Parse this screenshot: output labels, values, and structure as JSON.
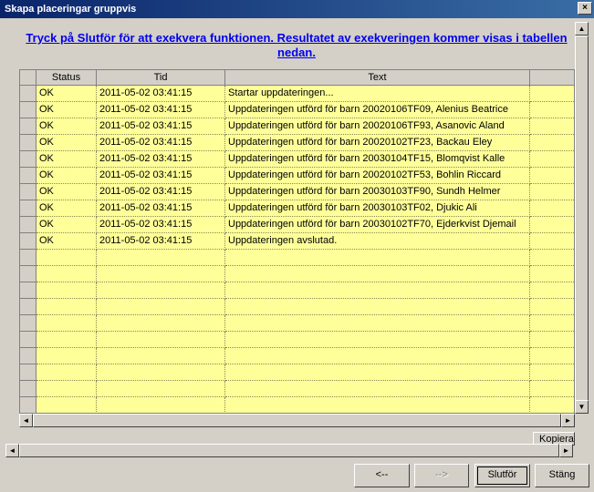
{
  "window": {
    "title": "Skapa placeringar gruppvis",
    "close_label": "×"
  },
  "instruction": "Tryck på Slutför för att exekvera funktionen. Resultatet av exekveringen kommer visas i tabellen nedan.",
  "table": {
    "columns": [
      "Status",
      "Tid",
      "Text"
    ],
    "rows": [
      [
        "OK",
        "2011-05-02 03:41:15",
        "Startar uppdateringen..."
      ],
      [
        "OK",
        "2011-05-02 03:41:15",
        "Uppdateringen utförd för barn 20020106TF09, Alenius Beatrice"
      ],
      [
        "OK",
        "2011-05-02 03:41:15",
        "Uppdateringen utförd för barn 20020106TF93, Asanovic Aland"
      ],
      [
        "OK",
        "2011-05-02 03:41:15",
        "Uppdateringen utförd för barn 20020102TF23, Backau Eley"
      ],
      [
        "OK",
        "2011-05-02 03:41:15",
        "Uppdateringen utförd för barn 20030104TF15, Blomqvist Kalle"
      ],
      [
        "OK",
        "2011-05-02 03:41:15",
        "Uppdateringen utförd för barn 20020102TF53, Bohlin Riccard"
      ],
      [
        "OK",
        "2011-05-02 03:41:15",
        "Uppdateringen utförd för barn 20030103TF90, Sundh Helmer"
      ],
      [
        "OK",
        "2011-05-02 03:41:15",
        "Uppdateringen utförd för barn 20030103TF02, Djukic Ali"
      ],
      [
        "OK",
        "2011-05-02 03:41:15",
        "Uppdateringen utförd för barn 20030102TF70, Ejderkvist Djemail"
      ],
      [
        "OK",
        "2011-05-02 03:41:15",
        "Uppdateringen avslutad."
      ],
      [
        "",
        "",
        ""
      ],
      [
        "",
        "",
        ""
      ],
      [
        "",
        "",
        ""
      ],
      [
        "",
        "",
        ""
      ],
      [
        "",
        "",
        ""
      ],
      [
        "",
        "",
        ""
      ],
      [
        "",
        "",
        ""
      ],
      [
        "",
        "",
        ""
      ],
      [
        "",
        "",
        ""
      ],
      [
        "",
        "",
        ""
      ]
    ],
    "cell_color": "#ffff99"
  },
  "kopiera_label": "Kopiera",
  "scroll_glyphs": {
    "up": "▲",
    "down": "▼",
    "left": "◄",
    "right": "►"
  },
  "buttons": {
    "back": "<--",
    "next": "-->",
    "finish": "Slutför",
    "close": "Stäng"
  }
}
